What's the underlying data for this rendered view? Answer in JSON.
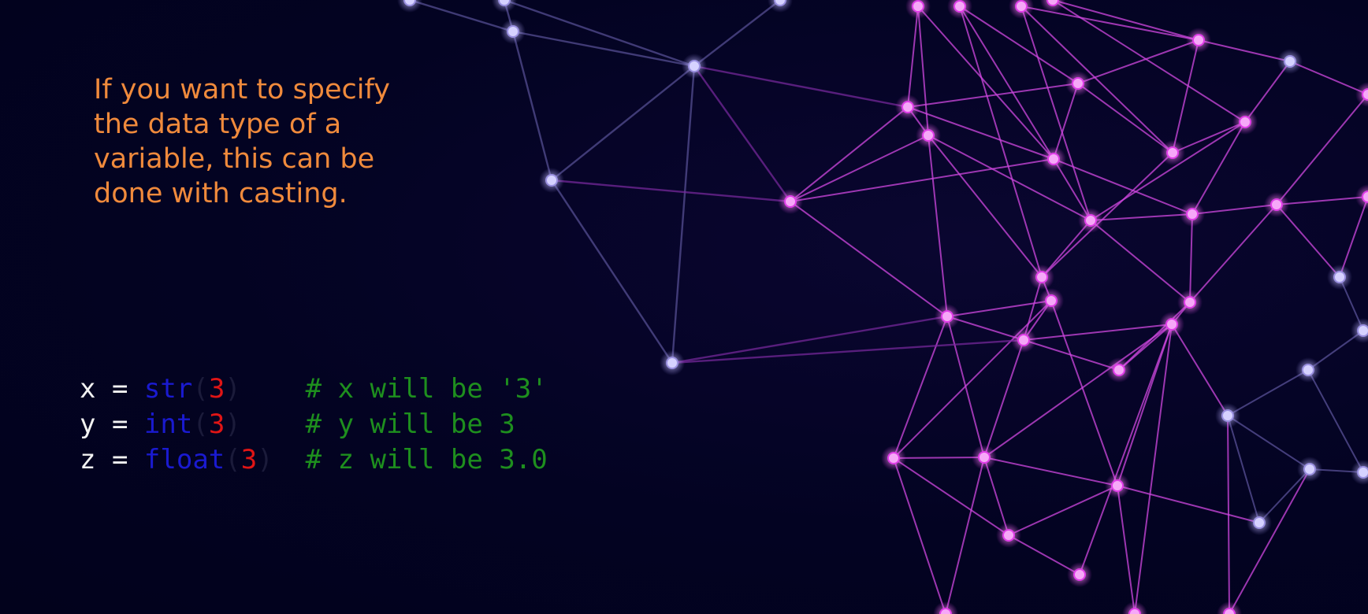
{
  "intro_text": "If you want to specify the data type of a variable, this can be done with casting.",
  "colors": {
    "intro_text": "#f08a3c",
    "code_plain": "#f2f2f2",
    "code_builtin": "#1a1ad0",
    "code_number": "#e01515",
    "code_paren": "#1b1b3a",
    "code_comment": "#1e8f1e",
    "network_near": "#e03ce8",
    "network_far": "#8a7fd8"
  },
  "code_lines": [
    {
      "var": "x",
      "assign": " = ",
      "func": "str",
      "open": "(",
      "arg": "3",
      "close": ")",
      "pad": "    ",
      "comment": "# x will be '3'"
    },
    {
      "var": "y",
      "assign": " = ",
      "func": "int",
      "open": "(",
      "arg": "3",
      "close": ")",
      "pad": "    ",
      "comment": "# y will be 3"
    },
    {
      "var": "z",
      "assign": " = ",
      "func": "float",
      "open": "(",
      "arg": "3",
      "close": ")",
      "pad": "  ",
      "comment": "# z will be 3.0"
    }
  ],
  "background": {
    "image": "network-graph",
    "style": "glowing purple and magenta nodes connected by lines"
  }
}
